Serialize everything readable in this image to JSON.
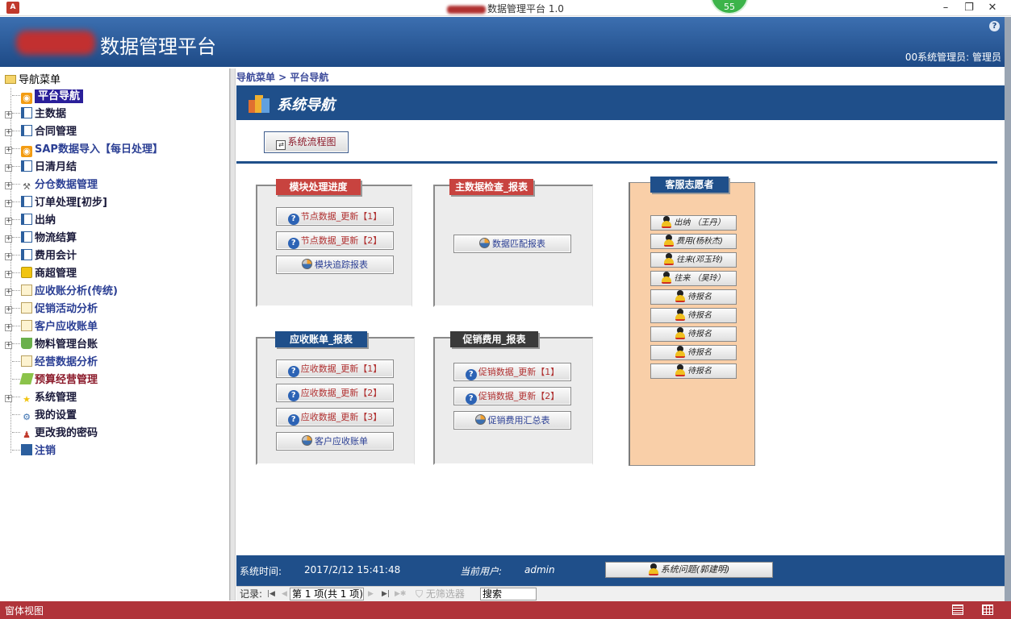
{
  "window": {
    "title": "数据管理平台 1.0",
    "badge": "55",
    "app_icon": "A"
  },
  "banner": {
    "title": "数据管理平台",
    "help": "?",
    "user": "00系统管理员: 管理员"
  },
  "tree": {
    "root": "导航菜单",
    "items": [
      {
        "label": "平台导航",
        "expand": false,
        "icon": "rss-icon",
        "color": "selected"
      },
      {
        "label": "主数据",
        "expand": true,
        "icon": "book-icon",
        "color": "dark"
      },
      {
        "label": "合同管理",
        "expand": true,
        "icon": "book-icon",
        "color": "dark"
      },
      {
        "label": "SAP数据导入【每日处理】",
        "expand": true,
        "icon": "rss-icon",
        "color": "blue"
      },
      {
        "label": "日清月结",
        "expand": true,
        "icon": "book-icon",
        "color": "dark"
      },
      {
        "label": "分仓数据管理",
        "expand": true,
        "icon": "tools-icon",
        "color": "blue"
      },
      {
        "label": "订单处理[初步]",
        "expand": true,
        "icon": "book-icon",
        "color": "dark"
      },
      {
        "label": "出纳",
        "expand": true,
        "icon": "book-icon",
        "color": "dark"
      },
      {
        "label": "物流结算",
        "expand": true,
        "icon": "book-icon",
        "color": "dark"
      },
      {
        "label": "费用会计",
        "expand": true,
        "icon": "book-icon",
        "color": "dark"
      },
      {
        "label": "商超管理",
        "expand": true,
        "icon": "bag-icon",
        "color": "dark"
      },
      {
        "label": "应收账分析(传统)",
        "expand": true,
        "icon": "document-icon",
        "color": "blue"
      },
      {
        "label": "促销活动分析",
        "expand": true,
        "icon": "document-icon",
        "color": "blue"
      },
      {
        "label": "客户应收账单",
        "expand": true,
        "icon": "document-icon",
        "color": "blue"
      },
      {
        "label": "物料管理台账",
        "expand": true,
        "icon": "basket-icon",
        "color": "dark"
      },
      {
        "label": "经营数据分析",
        "expand": false,
        "icon": "document-icon",
        "color": "blue"
      },
      {
        "label": "预算经营管理",
        "expand": false,
        "icon": "money-icon",
        "color": "red"
      },
      {
        "label": "系统管理",
        "expand": true,
        "icon": "star-icon",
        "color": "dark"
      },
      {
        "label": "我的设置",
        "expand": false,
        "icon": "gear-icon",
        "color": "dark"
      },
      {
        "label": "更改我的密码",
        "expand": false,
        "icon": "user-icon",
        "color": "dark"
      },
      {
        "label": "注销",
        "expand": false,
        "icon": "exit-icon",
        "color": "blue"
      }
    ]
  },
  "main": {
    "breadcrumb": "导航菜单 > 平台导航",
    "header_title": "系统导航",
    "flow_button": "系统流程图",
    "groups": {
      "module": {
        "title": "模块处理进度",
        "buttons": [
          "节点数据_更新【1】",
          "节点数据_更新【2】",
          "模块追踪报表"
        ]
      },
      "master": {
        "title": "主数据检查_报表",
        "buttons": [
          "数据匹配报表"
        ]
      },
      "receivable": {
        "title": "应收账单_报表",
        "buttons": [
          "应收数据_更新【1】",
          "应收数据_更新【2】",
          "应收数据_更新【3】",
          "客户应收账单"
        ]
      },
      "promo": {
        "title": "促销费用_报表",
        "buttons": [
          "促销数据_更新【1】",
          "促销数据_更新【2】",
          "促销费用汇总表"
        ]
      },
      "volunteers": {
        "title": "客服志愿者",
        "buttons": [
          "出纳 （王丹）",
          "费用(杨秋杰)",
          "往来(邓玉玲)",
          "往来 （吴玲）",
          "待报名",
          "待报名",
          "待报名",
          "待报名",
          "待报名"
        ]
      }
    },
    "footer": {
      "time_label": "系统时间:",
      "time_value": "2017/2/12 15:41:48",
      "user_label": "当前用户:",
      "user_value": "admin",
      "issue_button": "系统问题(郭建明)"
    }
  },
  "recnav": {
    "label": "记录:",
    "position": "第 1 项(共 1 项)",
    "filter": "无筛选器",
    "search": "搜索"
  },
  "statusbar": {
    "text": "窗体视图"
  }
}
